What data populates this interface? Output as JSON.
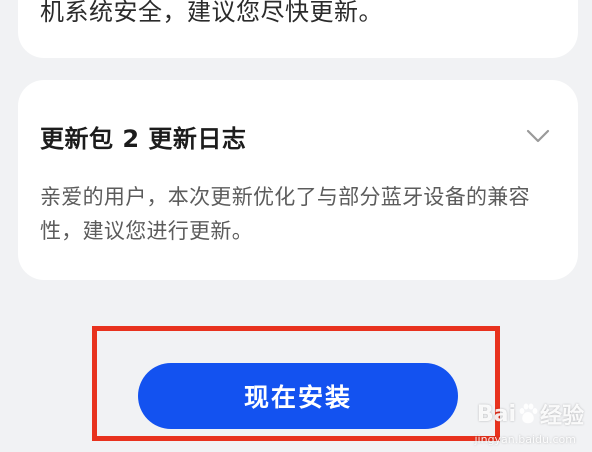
{
  "previous_card": {
    "text_fragment": "机系统安全，建议您尽快更新。"
  },
  "changelog": {
    "title": "更新包 2 更新日志",
    "expand_icon": "chevron-down-icon",
    "description": "亲爱的用户，本次更新优化了与部分蓝牙设备的兼容性，建议您进行更新。"
  },
  "actions": {
    "install_label": "现在安装"
  },
  "watermark": {
    "brand_left": "Bai",
    "brand_right": "经验",
    "url": "jingyan.baidu.com"
  },
  "colors": {
    "accent": "#1352f0",
    "highlight_box": "#e8321e",
    "background": "#f1f2f4",
    "card": "#ffffff"
  }
}
